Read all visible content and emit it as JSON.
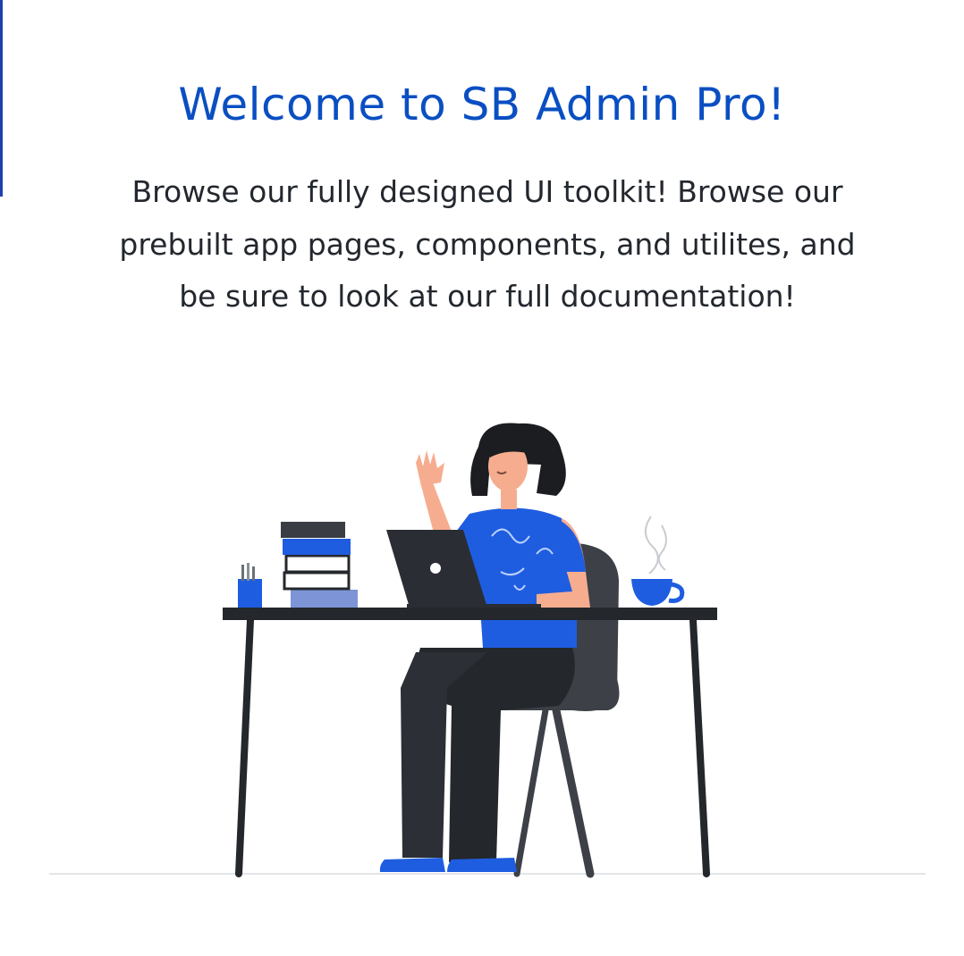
{
  "welcome": {
    "title": "Welcome to SB Admin Pro!",
    "description": "Browse our fully designed UI toolkit! Browse our prebuilt app pages, components, and utilites, and be sure to look at our full documentation!"
  },
  "illustration": {
    "subject": "woman-at-desk-with-laptop",
    "colors": {
      "accent": "#1f5de0",
      "dark": "#24272b",
      "skin": "#f6ad8f",
      "chair": "#3d4046",
      "title": "#0a4fc2",
      "text": "#23272e"
    }
  }
}
